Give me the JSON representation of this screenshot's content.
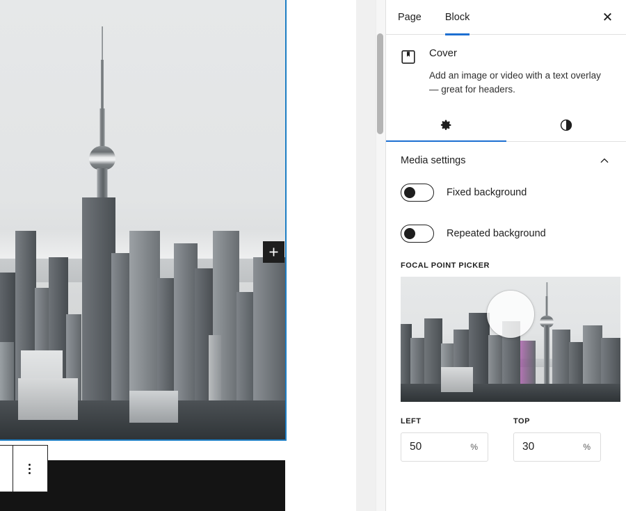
{
  "sidebar": {
    "tabs": [
      {
        "label": "Page",
        "active": false,
        "name": "tab-page"
      },
      {
        "label": "Block",
        "active": true,
        "name": "tab-block"
      }
    ],
    "close_label": "Close settings",
    "close_icon": "close-icon",
    "block_card": {
      "icon": "cover-block-icon",
      "title": "Cover",
      "description": "Add an image or video with a text overlay — great for headers."
    },
    "icon_tabs": [
      {
        "icon": "gear-icon",
        "label": "Settings",
        "active": true
      },
      {
        "icon": "contrast-icon",
        "label": "Styles",
        "active": false
      }
    ],
    "panel": {
      "title": "Media settings",
      "collapse_icon": "chevron-up-icon",
      "expanded": true,
      "toggles": [
        {
          "label": "Fixed background",
          "on": false,
          "name": "fixed-background-toggle"
        },
        {
          "label": "Repeated background",
          "on": false,
          "name": "repeated-background-toggle"
        }
      ],
      "focal_point": {
        "label": "FOCAL POINT PICKER",
        "left": {
          "label": "LEFT",
          "value": "50",
          "unit": "%"
        },
        "top": {
          "label": "TOP",
          "value": "30",
          "unit": "%"
        }
      }
    }
  },
  "canvas": {
    "cover_block": {
      "name": "cover-block",
      "selected": true,
      "selection_color": "#1d7ec4",
      "alt": "Black and white Toronto skyline with CN Tower"
    },
    "appender": {
      "icon": "plus-icon",
      "label": "Add block"
    },
    "block_toolbar": {
      "icon": "more-options-icon",
      "label": "Options"
    },
    "next_block": {
      "name": "black-cover-block"
    }
  },
  "colors": {
    "accent": "#1d6fd1",
    "selection": "#1d7ec4",
    "text": "#1e1e1e",
    "border": "#e0e0e0"
  }
}
